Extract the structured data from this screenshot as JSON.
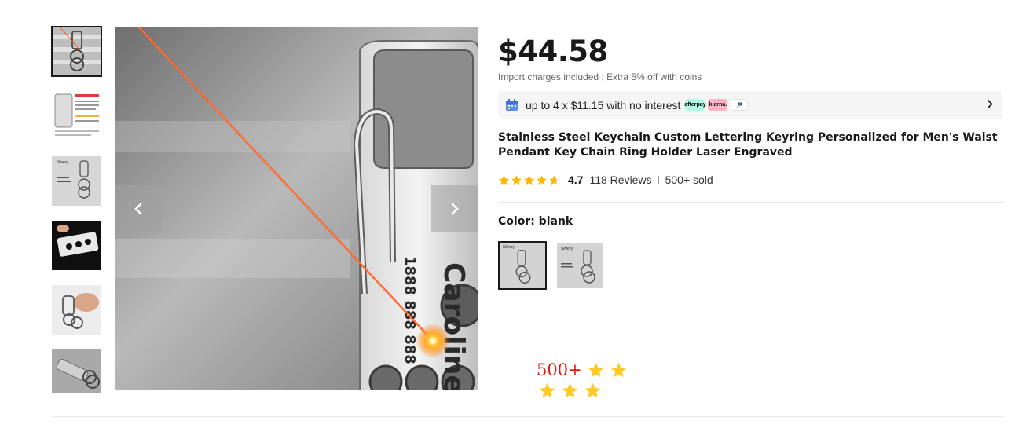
{
  "gallery": {
    "thumbnails": [
      {
        "label": "",
        "selected": true
      },
      {
        "label": "",
        "selected": false
      },
      {
        "label": "Silvery",
        "selected": false
      },
      {
        "label": "",
        "selected": false
      },
      {
        "label": "",
        "selected": false
      },
      {
        "label": "",
        "selected": false
      }
    ],
    "main_image_text": {
      "name": "Caroline",
      "phone": "1888 888 888"
    },
    "prev_icon": "chevron-left-icon",
    "next_icon": "chevron-right-icon"
  },
  "product": {
    "price": "$44.58",
    "price_note": "Import charges included ; Extra 5% off with coins",
    "installment_text": "up to 4 x $11.15 with no interest",
    "payment_badges": [
      "afterpay",
      "klarna.",
      "P"
    ],
    "title": "Stainless Steel Keychain Custom Lettering Keyring Personalized for Men's Waist Pendant Key Chain Ring Holder Laser Engraved",
    "rating": {
      "value": 4.7,
      "score_label": "4.7",
      "reviews": "118 Reviews",
      "sold": "500+ sold"
    },
    "color_label": "Color: blank",
    "swatches": [
      {
        "label": "Silvery",
        "selected": true
      },
      {
        "label": "Silvery",
        "selected": false
      }
    ]
  },
  "floating_badge": {
    "sold": "500+",
    "stars": 5
  },
  "colors": {
    "star": "#ffb800",
    "text": "#191919",
    "accent_red": "#e4180f",
    "laser": "#ff4a12"
  }
}
